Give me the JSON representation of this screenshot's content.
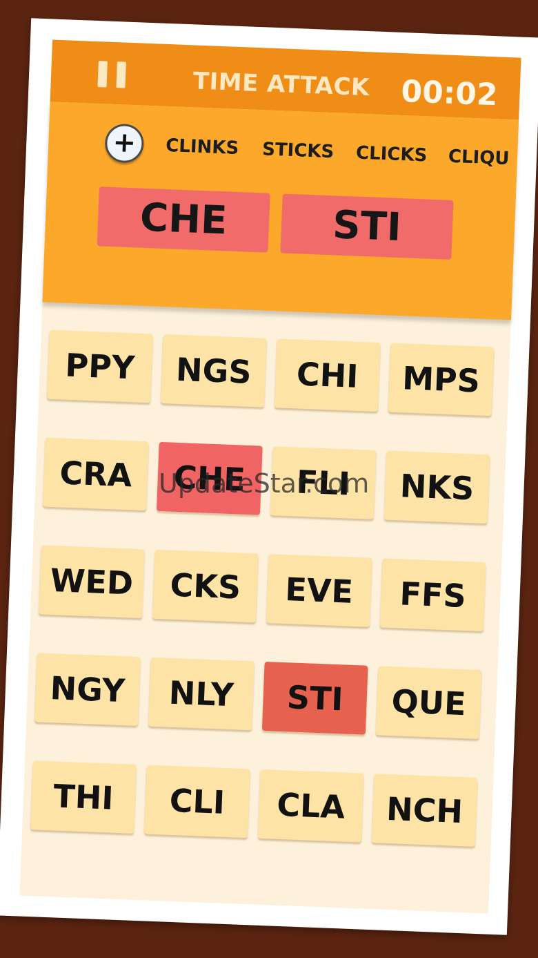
{
  "header": {
    "mode_title": "TIME ATTACK",
    "timer": "00:02"
  },
  "found_words": [
    "CLINKS",
    "STICKS",
    "CLICKS",
    "CLIQU"
  ],
  "add_button_label": "+",
  "current_word_slots": [
    "CHE",
    "STI"
  ],
  "tiles": [
    [
      "PPY",
      "NGS",
      "CHI",
      "MPS"
    ],
    [
      "CRA",
      "CHE",
      "FLI",
      "NKS"
    ],
    [
      "WED",
      "CKS",
      "EVE",
      "FFS"
    ],
    [
      "NGY",
      "NLY",
      "STI",
      "QUE"
    ],
    [
      "THI",
      "CLI",
      "CLA",
      "NCH"
    ]
  ],
  "selected_tiles": [
    "CHE",
    "STI"
  ],
  "watermark": "UpdateStar.com",
  "colors": {
    "header": "#f08d16",
    "word_area": "#fba82b",
    "slot": "#f26b6b",
    "tile": "#fde3a6",
    "tile_selected": "#f06464"
  }
}
